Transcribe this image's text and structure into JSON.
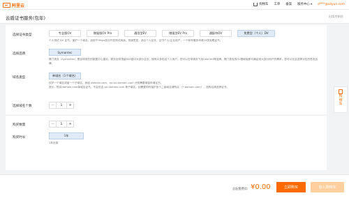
{
  "header": {
    "logo_text": "阿里云",
    "nav": {
      "cart": "购物车",
      "ticket": "工单",
      "filing": "备案",
      "support": "服务中心",
      "caret": "▾",
      "user": "sf***@aliyun.com"
    }
  },
  "titlebar": {
    "title": "云盾证书服务(包年)",
    "version": "旧版控制台"
  },
  "cert_type": {
    "label": "选择证书类型",
    "options": [
      {
        "label": "专业版OV"
      },
      {
        "label": "增强版OV Pro"
      },
      {
        "label": "通用型EV"
      },
      {
        "label": "增强型EV Pro"
      },
      {
        "label": "通配符DV"
      },
      {
        "label": "免费型（个人）DV",
        "selected": true
      }
    ],
    "note": "个人测试 DV 证书，保护一个域名，适用于Https部分开发测试用途。快速签发，适合个人站长、证书个人/企业用户，一个帐号最多申请20张免费证书。"
  },
  "brand": {
    "label": "选择品牌",
    "options": [
      {
        "label": "Symantec",
        "selected": true
      }
    ],
    "note": "赛门铁克（Symantec）是全球领先的数据中心建设，服务全球顶级500强中大部分企业，拥有众多知名个人用户。您可以在申请页下用GeoCert等品牌，赛门铁克的DV基础版即可满足绝大部分用户的需求，您可以在此选择对应的签发品牌。"
  },
  "domain_type": {
    "label": "域名类型",
    "options": [
      {
        "label": "单域名（1个域名）",
        "selected": true
      }
    ],
    "note_line1": "仅护一个域名或者一个子域名，例如 domain.com、ssl.ssl.domain.com 分别需要单独申请证书。",
    "note_line2": "提示：购买domain.com单域名证书，不会包含 ssl.domain.com 等子域名，如需要同时保护多个二级域名请购买 （*.domain.com），选购后请选择证书。"
  },
  "domain_count": {
    "label": "选择域名个数",
    "minus": "−",
    "value": "1",
    "plus": "+"
  },
  "quantity": {
    "label": "购买数量",
    "minus": "−",
    "value": "1",
    "plus": "+"
  },
  "duration": {
    "label": "购买时长",
    "options": [
      {
        "label": "1年",
        "selected": true
      }
    ],
    "note": "1年优惠"
  },
  "sidefloat": {
    "text": "购物车"
  },
  "footer": {
    "cost_label": "总配置费用:",
    "cost": "¥0.00",
    "buy": "立即购买",
    "add_cart": "加入购物车"
  },
  "colors": {
    "accent": "#ff6a00",
    "selected_bg": "#e1ebf7",
    "add_cart_bg": "#ffcf9e"
  }
}
